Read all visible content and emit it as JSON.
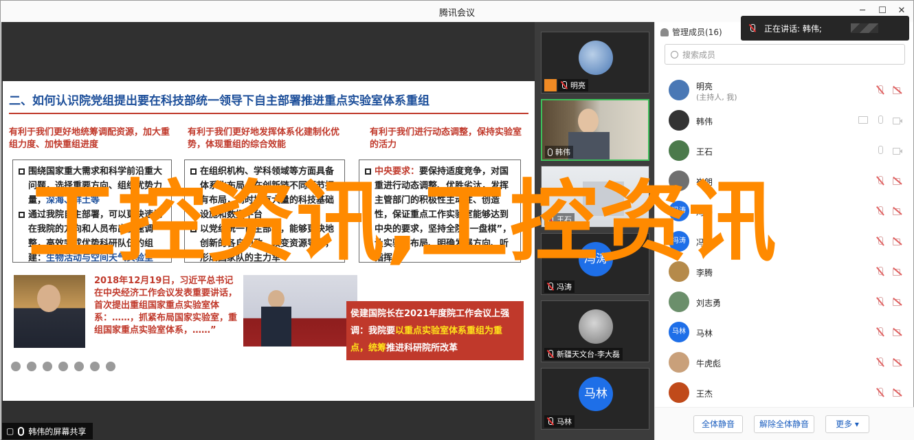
{
  "window": {
    "title": "腾讯会议",
    "min": "─",
    "max": "☐",
    "close": "✕"
  },
  "slide": {
    "title": "二、如何认识院党组提出要在科技部统一领导下自主部署推进重点实验室体系重组",
    "columns": [
      {
        "heading": "有利于我们更好地统筹调配资源，加大重组力度、加快重组进度",
        "bullets": [
          {
            "pre": "围绕国家重大需求和科学前沿重大问题，选择重要方向、组织优势力量，",
            "em": "深海、鲜土等"
          },
          {
            "pre": "通过我院自主部署，可以更快速地在我院的方向和人员布出快速调整，高效完成优势科研队伍的组建：",
            "em": "生物活动与空间天气实验室"
          }
        ]
      },
      {
        "heading": "有利于我们更好地发挥体系化建制化优势，体现重组的综合效能",
        "bullets": [
          {
            "pre": "在组织机构、学科领域等方面具备体系化布局，在创新链不同环节拥有布局，同时拥有大量的科技基础设施和数据平台",
            "em": ""
          },
          {
            "pre": "以党组统一自主部署，能够更快地创新的各自为政，改变资源导向，形成国家队的主力军",
            "em": ""
          }
        ]
      },
      {
        "heading": "有利于我们进行动态调整，保持实验室的活力",
        "bullets": [
          {
            "pre": "",
            "em": "中央要求：",
            "post": "要保持适度竞争，对国重进行动态调整、优胜劣汰，发挥主管部门的积极性主动性、创造性，保证重点工作实验室能够达到中央的要求，坚持全院“一盘棋”，让实验室布局、明确发展方向、听指挥"
          }
        ]
      }
    ],
    "quote": "2018年12月19日，习近平总书记在中央经济工作会议发表重要讲话，首次提出重组国家重点实验室体系：……，抓紧布局国家实验室，重组国家重点实验室体系，……”",
    "callout_lead": "侯建国院长在2021年度院工作会议上强调：我院要",
    "callout_em": "以重点实验室体系重组为重点，统筹",
    "callout_tail": "推进科研院所改革"
  },
  "sharer_label": "韩伟的屏幕共享",
  "video_tiles": [
    {
      "name": "明亮",
      "kind": "avatar",
      "color": "#4a78b5"
    },
    {
      "name": "韩伟",
      "kind": "video",
      "active": true
    },
    {
      "name": "王石",
      "kind": "video"
    },
    {
      "name": "冯涛",
      "kind": "text-avatar",
      "avatar_text": "冯涛"
    },
    {
      "name": "新疆天文台-李大磊",
      "kind": "avatar",
      "color": "#8f8f8f"
    },
    {
      "name": "马林",
      "kind": "text-avatar",
      "avatar_text": "马林"
    }
  ],
  "panel": {
    "header": "管理成员(16)",
    "search_placeholder": "搜索成员",
    "members": [
      {
        "name": "明亮",
        "sub": "(主持人, 我)",
        "color": "#4a78b5",
        "icons": [
          "micr",
          "camr"
        ]
      },
      {
        "name": "韩伟",
        "sub": "",
        "color": "#333333",
        "icons": [
          "scr",
          "micg",
          "camg"
        ]
      },
      {
        "name": "王石",
        "sub": "",
        "color": "#4b7a4b",
        "icons": [
          "micg",
          "camg"
        ]
      },
      {
        "name": "崔朗",
        "sub": "",
        "color": "#6f6f6f",
        "icons": [
          "micr",
          "camr"
        ]
      },
      {
        "name": "冯涛",
        "sub": "",
        "color": "#1e6fe8",
        "text": "冯涛",
        "icons": [
          "micr",
          "camr"
        ]
      },
      {
        "name": "冯涛",
        "sub": "",
        "color": "#1e6fe8",
        "text": "冯涛",
        "icons": [
          "micr",
          "camr"
        ]
      },
      {
        "name": "李腾",
        "sub": "",
        "color": "#b58a4a",
        "icons": [
          "micr",
          "camr"
        ]
      },
      {
        "name": "刘志勇",
        "sub": "",
        "color": "#6b8f6b",
        "icons": [
          "micr",
          "camr"
        ]
      },
      {
        "name": "马林",
        "sub": "",
        "color": "#1e6fe8",
        "text": "马林",
        "icons": [
          "micr",
          "camr"
        ]
      },
      {
        "name": "牛虎彪",
        "sub": "",
        "color": "#c9a07a",
        "icons": [
          "micr",
          "camr"
        ]
      },
      {
        "name": "王杰",
        "sub": "",
        "color": "#c04a1a",
        "icons": [
          "micr",
          "camr"
        ]
      }
    ],
    "btn_mute_all": "全体静音",
    "btn_unmute_all": "解除全体静音",
    "btn_more": "更多 ▾"
  },
  "toast": {
    "text": "正在讲话: 韩伟;"
  },
  "watermark": "工控资讯,工控资讯"
}
